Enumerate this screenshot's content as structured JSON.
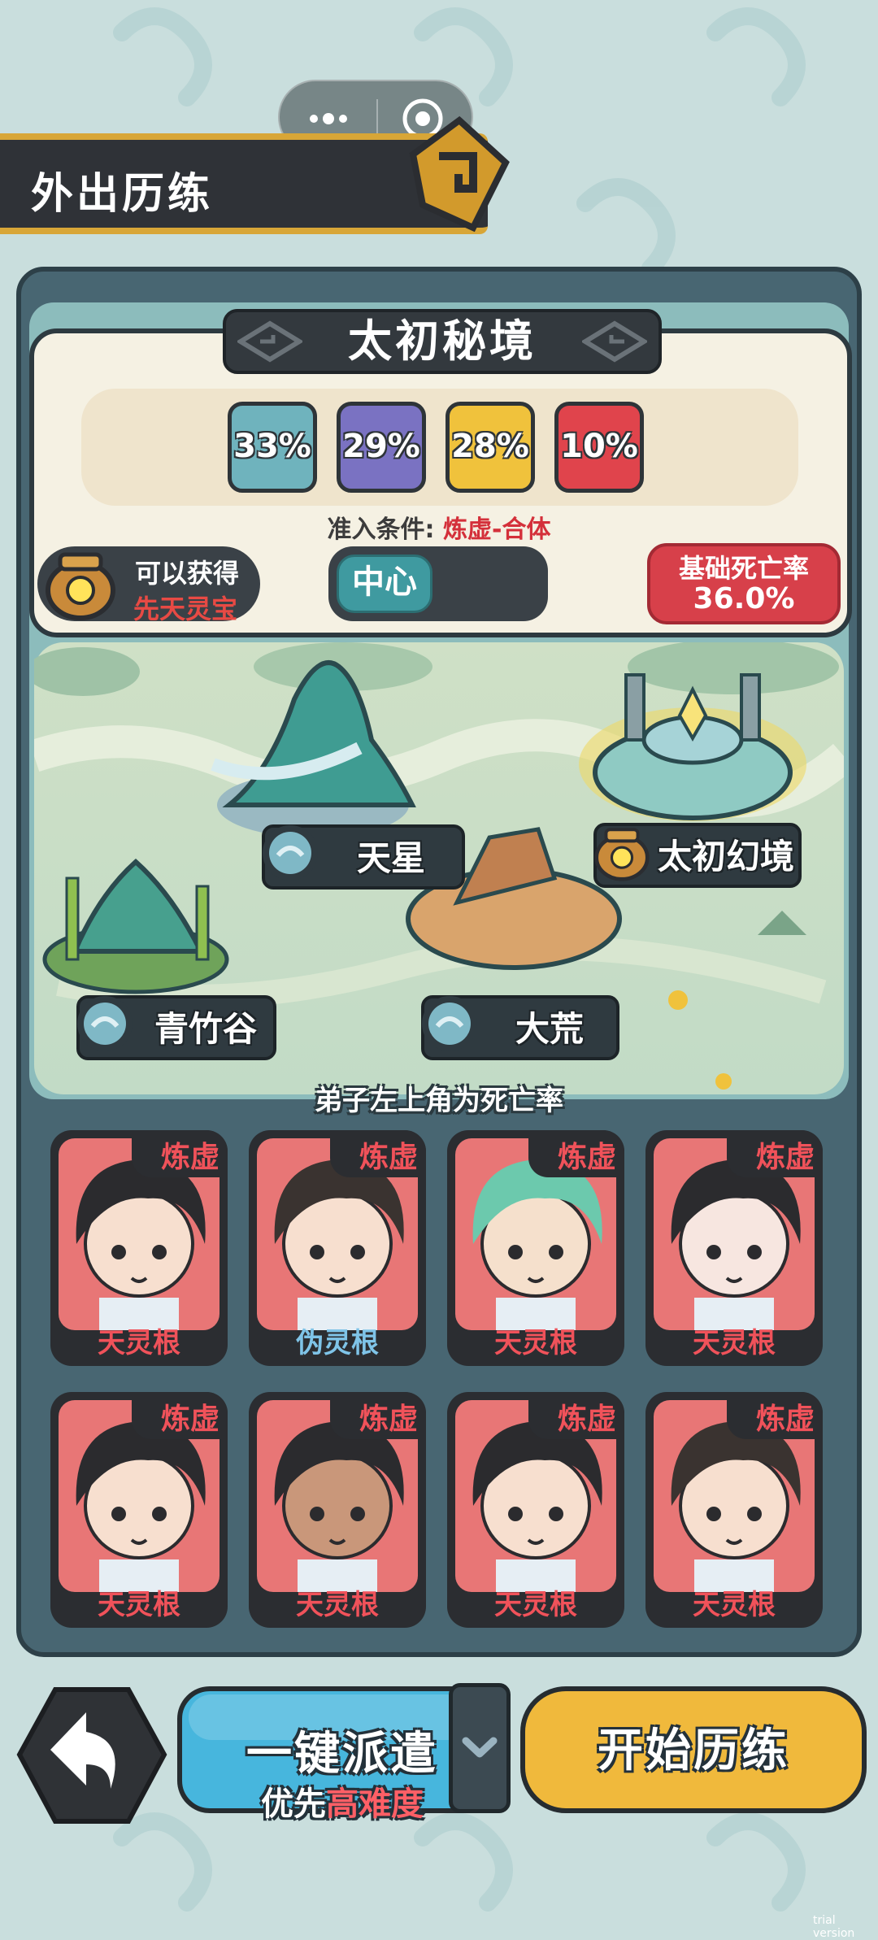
{
  "header": {
    "title": "外出历练"
  },
  "realm": {
    "title": "太初秘境",
    "probabilities": [
      {
        "value": "33%",
        "color": "#6fb3bd"
      },
      {
        "value": "29%",
        "color": "#7a72c2"
      },
      {
        "value": "28%",
        "color": "#f0c23c"
      },
      {
        "value": "10%",
        "color": "#e0444c"
      }
    ],
    "condition_label": "准入条件:",
    "condition_value": "炼虚-合体",
    "reward_line1": "可以获得",
    "reward_line2": "先天灵宝",
    "location_tag": "中心",
    "death_label": "基础死亡率",
    "death_value": "36.0%"
  },
  "map": {
    "locations": [
      {
        "name": "天星",
        "icon": "orb-icon"
      },
      {
        "name": "太初幻境",
        "icon": "treasure-cauldron-icon"
      },
      {
        "name": "青竹谷",
        "icon": "orb-icon"
      },
      {
        "name": "大荒",
        "icon": "orb-icon"
      }
    ]
  },
  "hint": "弟子左上角为死亡率",
  "disciples": [
    {
      "rank": "炼虚",
      "root": "天灵根",
      "root_color": "red"
    },
    {
      "rank": "炼虚",
      "root": "伪灵根",
      "root_color": "blue"
    },
    {
      "rank": "炼虚",
      "root": "天灵根",
      "root_color": "red"
    },
    {
      "rank": "炼虚",
      "root": "天灵根",
      "root_color": "red"
    },
    {
      "rank": "炼虚",
      "root": "天灵根",
      "root_color": "red"
    },
    {
      "rank": "炼虚",
      "root": "天灵根",
      "root_color": "red"
    },
    {
      "rank": "炼虚",
      "root": "天灵根",
      "root_color": "red"
    },
    {
      "rank": "炼虚",
      "root": "天灵根",
      "root_color": "red"
    }
  ],
  "bottom": {
    "dispatch_label": "一键派遣",
    "dispatch_sub_prefix": "优先",
    "dispatch_sub_emphasis": "高难度",
    "start_label": "开始历练"
  },
  "watermark": "trial version"
}
